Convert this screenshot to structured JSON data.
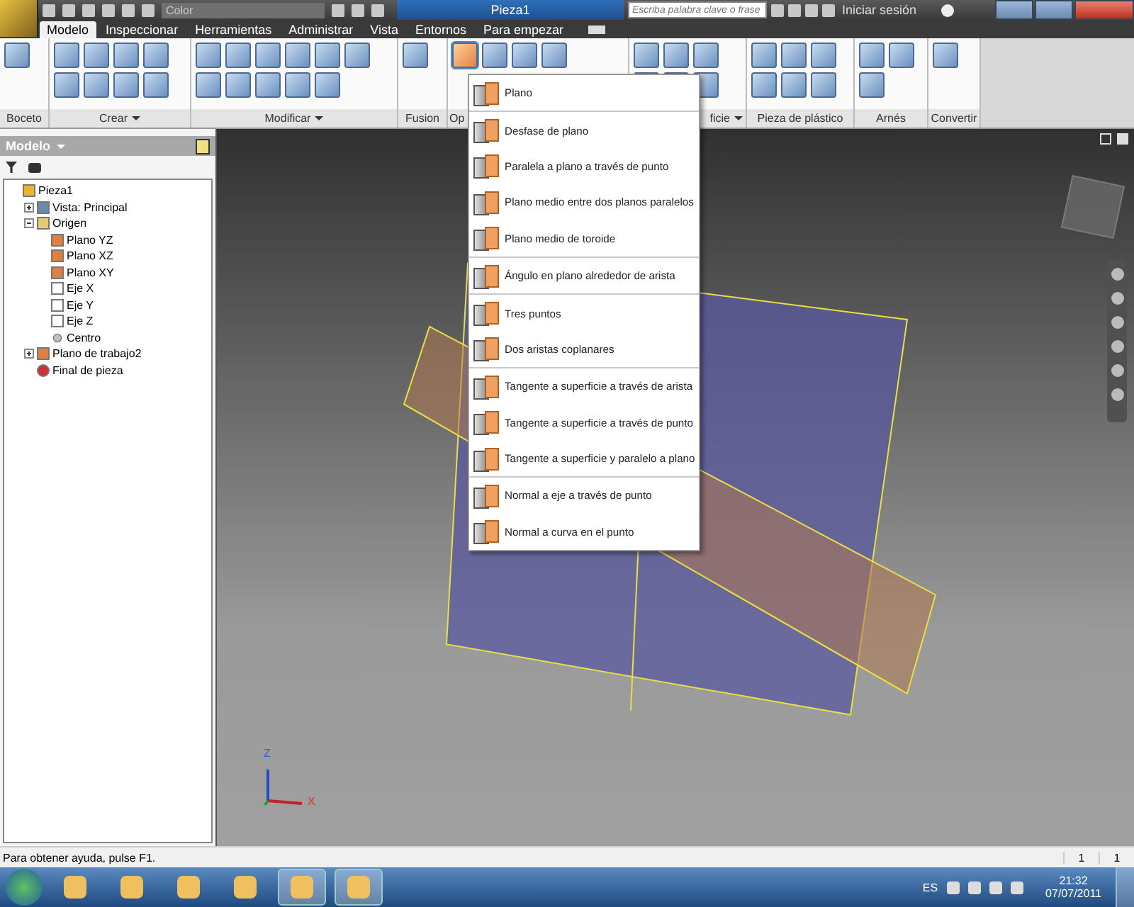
{
  "title_bar": {
    "style_field": "Color",
    "document_title": "Pieza1",
    "search_placeholder": "Escriba palabra clave o frase",
    "sign_in": "Iniciar sesión"
  },
  "ribbon_tabs": [
    {
      "label": "Modelo",
      "selected": true
    },
    {
      "label": "Inspeccionar",
      "selected": false
    },
    {
      "label": "Herramientas",
      "selected": false
    },
    {
      "label": "Administrar",
      "selected": false
    },
    {
      "label": "Vista",
      "selected": false
    },
    {
      "label": "Entornos",
      "selected": false
    },
    {
      "label": "Para empezar",
      "selected": false
    }
  ],
  "ribbon_panels": [
    {
      "label": "Boceto"
    },
    {
      "label": "Crear",
      "has_menu": true
    },
    {
      "label": "Modificar",
      "has_menu": true
    },
    {
      "label": "Fusion"
    },
    {
      "label": "Op"
    },
    {
      "label": "ficie",
      "has_menu": true
    },
    {
      "label": "Pieza de plástico"
    },
    {
      "label": "Arnés"
    },
    {
      "label": "Convertir"
    }
  ],
  "browser": {
    "title": "Modelo",
    "tree": [
      {
        "label": "Pieza1",
        "kind": "part",
        "children": [
          {
            "label": "Vista: Principal",
            "kind": "view",
            "expanded": false
          },
          {
            "label": "Origen",
            "kind": "folder",
            "expanded": true,
            "children": [
              {
                "label": "Plano YZ",
                "kind": "plane"
              },
              {
                "label": "Plano XZ",
                "kind": "plane"
              },
              {
                "label": "Plano XY",
                "kind": "plane"
              },
              {
                "label": "Eje X",
                "kind": "axis"
              },
              {
                "label": "Eje Y",
                "kind": "axis"
              },
              {
                "label": "Eje Z",
                "kind": "axis"
              },
              {
                "label": "Centro",
                "kind": "point"
              }
            ]
          },
          {
            "label": "Plano de trabajo2",
            "kind": "plane",
            "expanded": false
          },
          {
            "label": "Final de pieza",
            "kind": "end"
          }
        ]
      }
    ]
  },
  "plane_menu": {
    "groups": [
      [
        "Plano"
      ],
      [
        "Desfase de plano",
        "Paralela a plano a través de punto",
        "Plano medio entre dos planos paralelos",
        "Plano medio de toroide"
      ],
      [
        "Ángulo en plano alrededor de arista"
      ],
      [
        "Tres puntos",
        "Dos aristas coplanares"
      ],
      [
        "Tangente a superficie a través de arista",
        "Tangente a superficie a través de punto",
        "Tangente a superficie y paralelo a plano"
      ],
      [
        "Normal a eje a través de punto",
        "Normal a curva en el punto"
      ]
    ]
  },
  "viewport": {
    "axis_labels": [
      "Z",
      "X"
    ]
  },
  "status_bar": {
    "message": "Para obtener ayuda, pulse F1.",
    "fields": [
      "1",
      "1"
    ]
  },
  "taskbar": {
    "language": "ES",
    "time": "21:32",
    "date": "07/07/2011"
  }
}
